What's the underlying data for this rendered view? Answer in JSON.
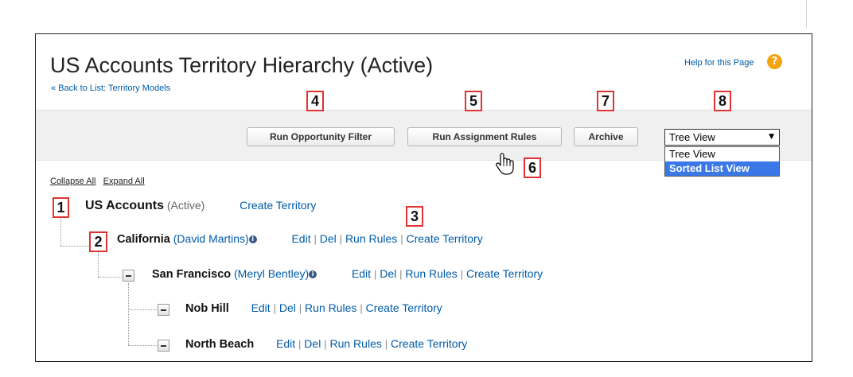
{
  "page": {
    "title": "US Accounts Territory Hierarchy (Active)",
    "back_link": "« Back to List: Territory Models",
    "help_link": "Help for this Page",
    "help_icon_glyph": "?"
  },
  "toolbar": {
    "run_opportunity_filter": "Run Opportunity Filter",
    "run_assignment_rules": "Run Assignment Rules",
    "archive": "Archive",
    "view_selected": "Tree View",
    "view_options": [
      "Tree View",
      "Sorted List View"
    ],
    "highlighted_option": "Sorted List View"
  },
  "tree_controls": {
    "collapse_all": "Collapse All",
    "expand_all": "Expand All"
  },
  "tree": {
    "root": {
      "name": "US Accounts",
      "status": "(Active)",
      "create": "Create Territory"
    },
    "california": {
      "name": "California",
      "owner": "(David Martins)",
      "edit": "Edit",
      "del": "Del",
      "run": "Run Rules",
      "create": "Create Territory"
    },
    "san_francisco": {
      "name": "San Francisco",
      "owner": "(Meryl Bentley)",
      "edit": "Edit",
      "del": "Del",
      "run": "Run Rules",
      "create": "Create Territory"
    },
    "nob_hill": {
      "name": "Nob Hill",
      "edit": "Edit",
      "del": "Del",
      "run": "Run Rules",
      "create": "Create Territory"
    },
    "north_beach": {
      "name": "North Beach",
      "edit": "Edit",
      "del": "Del",
      "run": "Run Rules",
      "create": "Create Territory"
    },
    "separator": "|",
    "info_glyph": "i"
  },
  "callouts": {
    "c1": "1",
    "c2": "2",
    "c3": "3",
    "c4": "4",
    "c5": "5",
    "c6": "6",
    "c7": "7",
    "c8": "8"
  },
  "icons": {
    "help": "help-icon",
    "info": "info-icon",
    "collapse": "collapse-icon",
    "cursor": "hand-cursor-icon"
  },
  "colors": {
    "link": "#015ba7",
    "callout_border": "#e03333",
    "help_icon": "#f2a30f",
    "selected_option": "#3b78e7",
    "toolbar_bg": "#f0f0f0"
  }
}
